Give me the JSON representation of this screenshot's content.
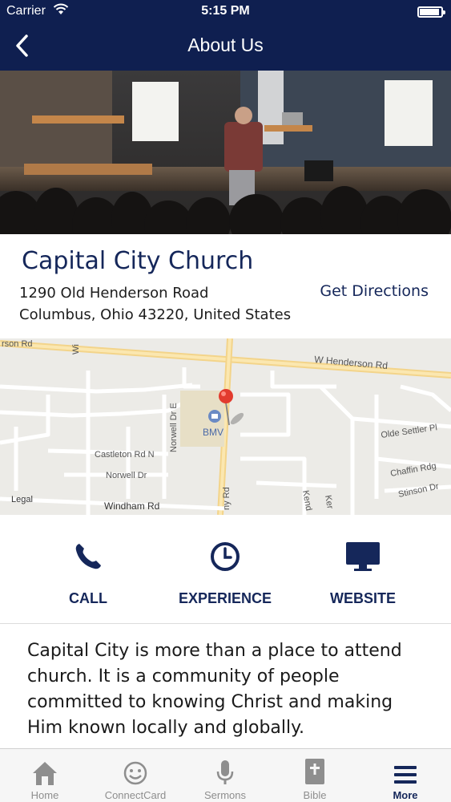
{
  "status_bar": {
    "carrier": "Carrier",
    "time": "5:15 PM"
  },
  "nav": {
    "title": "About Us",
    "back_icon": "chevron-left-icon"
  },
  "church": {
    "name": "Capital City Church",
    "address_line1": "1290 Old Henderson Road",
    "address_line2": "Columbus, Ohio 43220, United States",
    "directions_label": "Get Directions"
  },
  "map": {
    "labels": {
      "road_top_left": "rson Rd",
      "w_henderson": "W Henderson Rd",
      "norwell_dr_e": "Norwell Dr E",
      "bmv": "BMV",
      "castleton": "Castleton Rd N",
      "norwell_dr": "Norwell Dr",
      "windham": "Windham Rd",
      "legal": "Legal",
      "olde_settler": "Olde Settler Pl",
      "chaffin": "Chaffin Rdg",
      "stinson": "Stinson Dr",
      "kend": "Kend",
      "ny_rd": "ny Rd",
      "wi": "Wi",
      "ker": "Ker"
    }
  },
  "actions": [
    {
      "label": "CALL",
      "icon": "phone-icon"
    },
    {
      "label": "EXPERIENCE",
      "icon": "clock-icon"
    },
    {
      "label": "WEBSITE",
      "icon": "monitor-icon"
    }
  ],
  "description": "Capital City is more than a place to attend church. It is a community of people committed to knowing Christ and making Him known locally and globally.",
  "tabs": [
    {
      "label": "Home",
      "icon": "home-icon"
    },
    {
      "label": "ConnectCard",
      "icon": "smiley-icon"
    },
    {
      "label": "Sermons",
      "icon": "microphone-icon"
    },
    {
      "label": "Bible",
      "icon": "bible-icon"
    },
    {
      "label": "More",
      "icon": "menu-icon",
      "active": true
    }
  ],
  "colors": {
    "navy": "#0f1f50",
    "accent": "#15275a",
    "pin": "#e23b2e"
  }
}
